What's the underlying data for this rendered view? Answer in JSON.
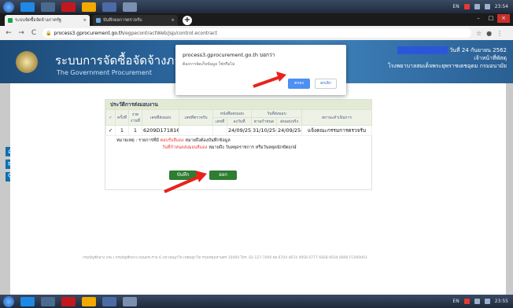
{
  "taskbar": {
    "time": "23:54",
    "time_bottom": "23:55",
    "lang": "EN"
  },
  "browser": {
    "tabs": [
      {
        "label": "ระบบจัดซื้อจัดจ้างภาครัฐ"
      },
      {
        "label": "บันทึกผลการตรวจรับ"
      }
    ],
    "url_host": "process3.gprocurement.go.th",
    "url_path": "/egpecontractWeb/jsp/control.econtract"
  },
  "site": {
    "title": "ระบบการจัดซื้อจัดจ้างภาครัฐ",
    "subtitle": "The Government Procurement",
    "header_right_line1": "วันที่ 24 กันยายน 2562",
    "header_right_line2": "เจ้าหน้าที่พัสดุ",
    "header_right_line3": "โรงพยาบาลสมเด็จพระยุพราชเดชอุดม กรมอนามัย"
  },
  "panel": {
    "title": "ประวัติการส่งมอบงาน",
    "headers": {
      "check": "✓",
      "no": "ครั้งที่",
      "period": "งวดงานที่",
      "delivery_no": "เลขที่ส่งมอบ",
      "receive_no": "เลขที่ตรวจรับ",
      "doc_group": "หนังสือส่งมอบ",
      "doc_no": "เลขที่",
      "doc_date": "ลงวันที่",
      "date_group": "วันที่ส่งมอบ",
      "due": "ตามกำหนด",
      "actual": "ส่งมอบจริง",
      "status": "สถานะดำเนินการ"
    },
    "rows": [
      {
        "check": "✓",
        "no": "1",
        "period": "1",
        "delivery_no": "6209D1718164",
        "receive_no": "",
        "doc_no": "",
        "doc_date": "24/09/2562",
        "due": "31/10/2562",
        "actual": "24/09/2562",
        "status": "แจ้งคณะกรรมการตรวจรับ"
      }
    ],
    "remark_label": "หมายเหตุ :",
    "remark_text_a": "รายการที่มี",
    "remark_red_a": "ตอบรับสีแดง",
    "remark_text_b": "หมายถึงต้องบันทึกข้อมูล",
    "remark_red_b": "วันที่กำหนดส่งมอบสีแดง",
    "remark_text_c": "หมายถึง วันหยุดราชการ หรือวันหยุดนักขัตฤกษ์",
    "save_label": "บันทึก",
    "exit_label": "ออก"
  },
  "footer": "กรมบัญชีกลาง (กพ.) กรมบัญชีกลาง ถนนพระราม 6 แขวงพญาไท เขตพญาไท กรุงเทพมหานคร 10400 โทร. 02-127-7000 ต่อ 6704 4674 4958 6777 6928 6934 6800   FC000001",
  "dialog": {
    "title": "process3.gprocurement.go.th บอกว่า",
    "message": "ต้องการจัดเก็บข้อมูล ใช่หรือไม่",
    "ok_label": "ตกลง",
    "cancel_label": "ยกเลิก"
  },
  "colors": {
    "banner": "#2d6aa3",
    "ok": "#4d8ff3",
    "action": "#2e7d32",
    "arrow": "#e8231c"
  }
}
